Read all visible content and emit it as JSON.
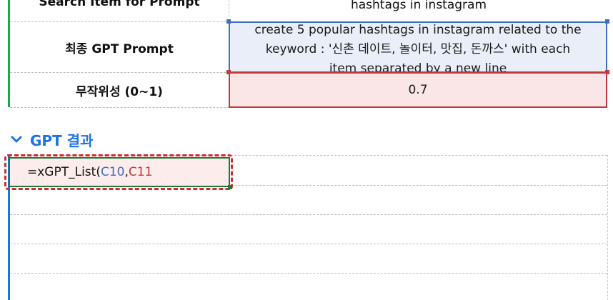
{
  "top_table": {
    "row_search": {
      "label": "Search Item for Prompt",
      "value": "hashtags in instagram"
    },
    "row_prompt": {
      "label": "최종 GPT Prompt",
      "lines": [
        "create 5 popular hashtags in instagram related to the",
        "keyword : '신촌 데이트, 놀이터, 맛집, 돈까스' with each",
        "item separated by a new line"
      ]
    },
    "row_random": {
      "label": "무작위성 (0~1)",
      "value": "0.7"
    }
  },
  "section": {
    "title": "GPT 결과",
    "icon": "chevron-down-icon"
  },
  "formula": {
    "prefix": "=xGPT_List(",
    "ref1": "C10",
    "sep": ",",
    "ref2": "C11"
  },
  "colors": {
    "accent_blue": "#1a73e8",
    "green": "#1aa84a",
    "ref_blue": "#3c6fc0",
    "ref_red": "#c0393b"
  }
}
